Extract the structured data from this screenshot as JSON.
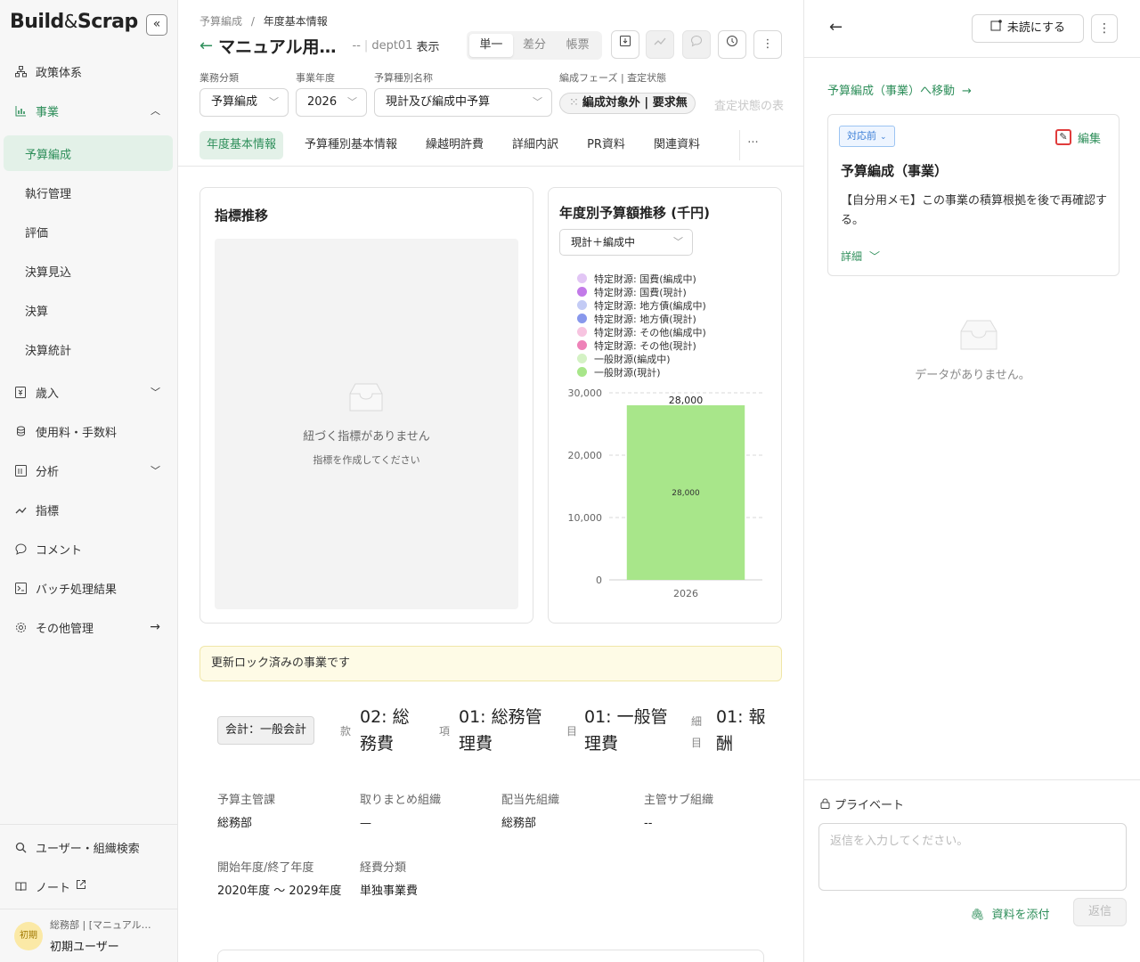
{
  "sidebar": {
    "logo_left": "Build",
    "logo_amp": "&",
    "logo_right": "Scrap",
    "collapse_glyph": "«",
    "items": [
      {
        "label": "政策体系"
      },
      {
        "label": "事業"
      },
      {
        "label": "歳入"
      },
      {
        "label": "使用料・手数料"
      },
      {
        "label": "分析"
      },
      {
        "label": "指標"
      },
      {
        "label": "コメント"
      },
      {
        "label": "バッチ処理結果"
      },
      {
        "label": "その他管理"
      }
    ],
    "sub_items": [
      {
        "label": "予算編成"
      },
      {
        "label": "執行管理"
      },
      {
        "label": "評価"
      },
      {
        "label": "決算見込"
      },
      {
        "label": "決算"
      },
      {
        "label": "決算統計"
      }
    ],
    "bottom": {
      "search": "ユーザー・組織検索",
      "note": "ノート"
    },
    "user": {
      "avatar": "初期",
      "org": "総務部 | [マニュアル…",
      "name": "初期ユーザー"
    }
  },
  "header": {
    "breadcrumb_parent": "予算編成",
    "breadcrumb_sep": "/",
    "breadcrumb_current": "年度基本情報",
    "title": "マニュアル用…",
    "dept_prefix": "--",
    "dept": "dept01",
    "display_label": "表示",
    "modes": [
      "単一",
      "差分",
      "帳票"
    ]
  },
  "filters": {
    "business_label": "業務分類",
    "business_value": "予算編成",
    "year_label": "事業年度",
    "year_value": "2026",
    "type_label": "予算種別名称",
    "type_value": "現計及び編成中予算",
    "phase_label": "編成フェーズ | 査定状態",
    "phase_value": "編成対象外 | 要求無",
    "faded_label": "査定状態の表"
  },
  "tabs": [
    "年度基本情報",
    "予算種別基本情報",
    "繰越明許費",
    "詳細内訳",
    "PR資料",
    "関連資料"
  ],
  "tab_more": "···",
  "indicator_card": {
    "title": "指標推移",
    "empty_main": "紐づく指標がありません",
    "empty_sub": "指標を作成してください"
  },
  "budget_card": {
    "title": "年度別予算額推移 (千円)",
    "select_value": "現計＋編成中"
  },
  "chart_data": {
    "type": "bar",
    "title": "年度別予算額推移 (千円)",
    "categories": [
      "2026"
    ],
    "ylim": [
      0,
      30000
    ],
    "yticks": [
      0,
      10000,
      20000,
      30000
    ],
    "grid": true,
    "legend_position": "top",
    "series": [
      {
        "name": "特定財源: 国費(編成中)",
        "color": "#e2c6f5",
        "values": [
          0
        ]
      },
      {
        "name": "特定財源: 国費(現計)",
        "color": "#c27ae8",
        "values": [
          0
        ]
      },
      {
        "name": "特定財源: 地方債(編成中)",
        "color": "#c3cbf5",
        "values": [
          0
        ]
      },
      {
        "name": "特定財源: 地方債(現計)",
        "color": "#8898ec",
        "values": [
          0
        ]
      },
      {
        "name": "特定財源: その他(編成中)",
        "color": "#f7c4e0",
        "values": [
          0
        ]
      },
      {
        "name": "特定財源: その他(現計)",
        "color": "#ee82b8",
        "values": [
          0
        ]
      },
      {
        "name": "一般財源(編成中)",
        "color": "#d4f2c4",
        "values": [
          0
        ]
      },
      {
        "name": "一般財源(現計)",
        "color": "#a8e68a",
        "values": [
          28000
        ]
      }
    ],
    "total_labels": [
      "28,000"
    ],
    "inner_labels": [
      "28,000"
    ]
  },
  "banner": "更新ロック済みの事業です",
  "segments": {
    "account": "会計：一般会計",
    "kan_label": "款",
    "kan_value": "02: 総務費",
    "kou_label": "項",
    "kou_value": "01: 総務管理費",
    "moku_label": "目",
    "moku_value": "01: 一般管理費",
    "saimoku_label": "細目",
    "saimoku_value": "01: 報酬"
  },
  "info": {
    "dept_label": "予算主管課",
    "dept_value": "総務部",
    "summary_label": "取りまとめ組織",
    "summary_value": "—",
    "alloc_label": "配当先組織",
    "alloc_value": "総務部",
    "sub_label": "主管サブ組織",
    "sub_value": "--",
    "period_label": "開始年度/終了年度",
    "period_value": "2020年度 〜 2029年度",
    "cost_label": "経費分類",
    "cost_value": "単独事業費"
  },
  "right_panel": {
    "unread_button": "未読にする",
    "goto_link": "予算編成（事業）へ移動",
    "status_tag": "対応前",
    "edit_label": "編集",
    "card_title": "予算編成（事業）",
    "memo": "【自分用メモ】この事業の積算根拠を後で再確認する。",
    "detail_link": "詳細",
    "no_data": "データがありません。",
    "private_label": "プライベート",
    "reply_placeholder": "返信を入力してください。",
    "attach_label": "資料を添付",
    "send_label": "返信"
  }
}
